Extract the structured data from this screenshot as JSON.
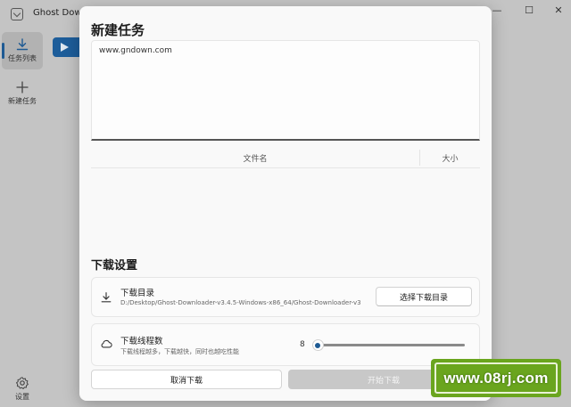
{
  "app": {
    "title": "Ghost Downl",
    "window_controls": {
      "minimize": "—",
      "maximize": "☐",
      "close": "✕"
    }
  },
  "sidebar": {
    "items": [
      {
        "label": "任务列表",
        "icon": "download-icon",
        "active": true
      },
      {
        "label": "新建任务",
        "icon": "plus-icon",
        "active": false
      },
      {
        "label": "设置",
        "icon": "gear-icon",
        "active": false
      }
    ]
  },
  "dialog": {
    "title": "新建任务",
    "url_input": {
      "value": "www.gndown.com"
    },
    "file_table": {
      "columns": [
        "文件名",
        "大小"
      ],
      "rows": []
    },
    "settings_title": "下载设置",
    "directory": {
      "label": "下载目录",
      "path": "D:/Desktop/Ghost-Downloader-v3.4.5-Windows-x86_64/Ghost-Downloader-v3",
      "button": "选择下载目录",
      "icon": "download-icon"
    },
    "threads": {
      "label": "下载线程数",
      "description": "下载线程越多，下载越快，同时也越吃性能",
      "value": "8",
      "level": 0,
      "icon": "cloud-icon"
    },
    "cancel_button": "取消下载",
    "start_button": "开始下载"
  },
  "watermark": {
    "text": "www.08rj.com"
  },
  "colors": {
    "accent": "#1e5a93",
    "watermark": "#6aa51e",
    "disabled": "#c8c8c8"
  }
}
